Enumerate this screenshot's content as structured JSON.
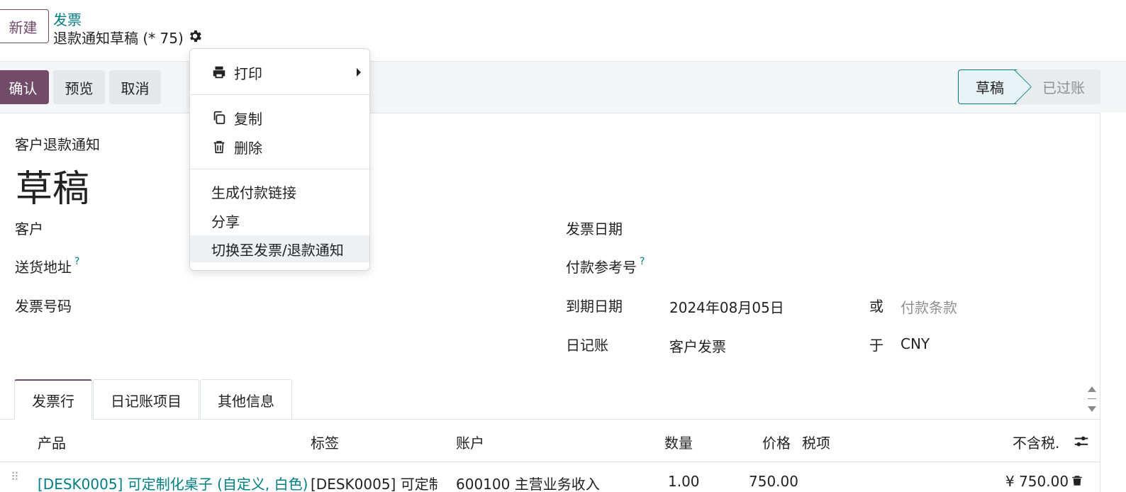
{
  "header": {
    "new_button": "新建",
    "breadcrumb_parent": "发票",
    "breadcrumb_current": "退款通知草稿 (* 75)"
  },
  "toolbar": {
    "confirm": "确认",
    "preview": "预览",
    "cancel": "取消"
  },
  "statusbar": {
    "draft": "草稿",
    "posted": "已过账"
  },
  "form": {
    "doc_type": "客户退款通知",
    "title": "草稿",
    "customer_label": "客户",
    "delivery_label": "送货地址",
    "invoice_number_label": "发票号码",
    "invoice_date_label": "发票日期",
    "payment_ref_label": "付款参考号",
    "due_date_label": "到期日期",
    "due_date_value": "2024年08月05日",
    "or_label": "或",
    "payment_terms_placeholder": "付款条款",
    "journal_label": "日记账",
    "journal_value": "客户发票",
    "in_label": "于",
    "currency_value": "CNY",
    "help_mark": "?"
  },
  "tabs": [
    "发票行",
    "日记账项目",
    "其他信息"
  ],
  "table": {
    "headers": {
      "product": "产品",
      "label": "标签",
      "account": "账户",
      "quantity": "数量",
      "price": "价格",
      "taxes": "税项",
      "subtotal": "不含税."
    },
    "rows": [
      {
        "product": "[DESK0005] 可定制化桌子 (自定义, 白色)",
        "label": "[DESK0005] 可定制",
        "account": "600100 主营业务收入",
        "quantity": "1.00",
        "price": "750.00",
        "subtotal": "¥ 750.00"
      }
    ]
  },
  "dropdown": {
    "print": "打印",
    "duplicate": "复制",
    "delete": "删除",
    "payment_link": "生成付款链接",
    "share": "分享",
    "switch": "切换至发票/退款通知"
  },
  "colors": {
    "primary": "#714b67",
    "link": "#017e84"
  }
}
